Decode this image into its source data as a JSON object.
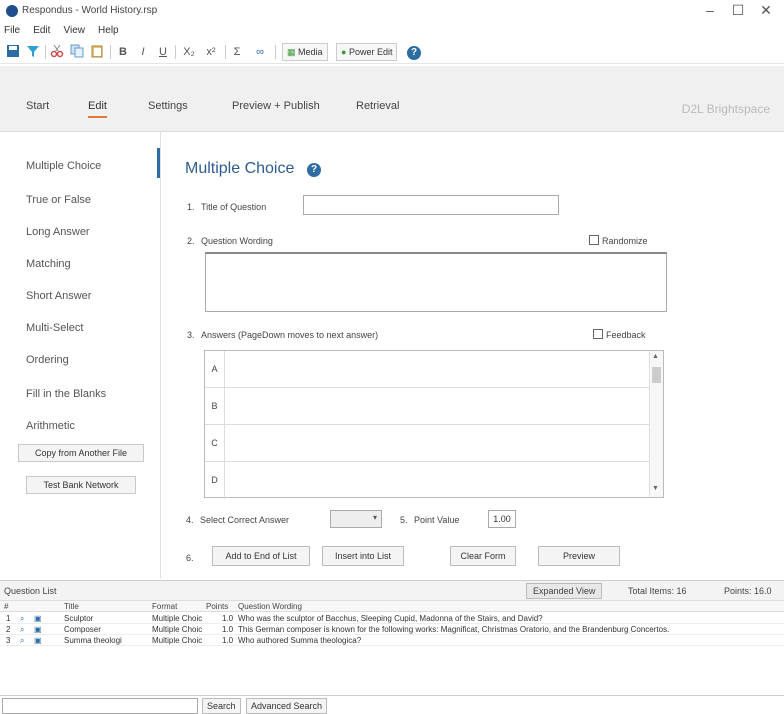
{
  "window": {
    "title": "Respondus - World History.rsp",
    "controls": [
      "–",
      "☐",
      "✕"
    ]
  },
  "menu": [
    "File",
    "Edit",
    "View",
    "Help"
  ],
  "toolbar": {
    "bold": "B",
    "italic": "I",
    "underline": "U",
    "sub": "X₂",
    "sup": "x²",
    "sigma": "Σ",
    "link": "∞",
    "media_label": "Media",
    "power_edit_label": "Power Edit",
    "help": "?"
  },
  "tabs": [
    "Start",
    "Edit",
    "Settings",
    "Preview + Publish",
    "Retrieval"
  ],
  "active_tab": "Edit",
  "lms_label": "D2L Brightspace",
  "sidebar": {
    "items": [
      "Multiple Choice",
      "True or False",
      "Long Answer",
      "Matching",
      "Short Answer",
      "Multi-Select",
      "Ordering",
      "Fill in the Blanks",
      "Arithmetic"
    ],
    "active": "Multiple Choice",
    "copy_button": "Copy from Another File",
    "testbank_button": "Test Bank Network"
  },
  "main": {
    "heading": "Multiple Choice",
    "help_icon": "?",
    "step1": {
      "num": "1.",
      "label": "Title of Question",
      "value": ""
    },
    "step2": {
      "num": "2.",
      "label": "Question Wording",
      "randomize": "Randomize"
    },
    "step3": {
      "num": "3.",
      "label": "Answers (PageDown moves to next answer)",
      "feedback": "Feedback"
    },
    "answer_letters": [
      "A",
      "B",
      "C",
      "D"
    ],
    "step4": {
      "num": "4.",
      "label": "Select Correct Answer",
      "value": ""
    },
    "step5": {
      "num": "5.",
      "label": "Point Value",
      "value": "1.00"
    },
    "step6": {
      "num": "6."
    },
    "buttons": {
      "add": "Add to End of List",
      "insert": "Insert into List",
      "clear": "Clear Form",
      "preview": "Preview"
    }
  },
  "question_list": {
    "title": "Question List",
    "expanded_view": "Expanded View",
    "total_items": "Total Items: 16",
    "points": "Points: 16.0",
    "columns": [
      "#",
      "",
      "",
      "Title",
      "Format",
      "Points",
      "Question Wording"
    ],
    "rows": [
      {
        "n": "1",
        "title": "Sculptor",
        "format": "Multiple Choic",
        "points": "1.0",
        "wording": "Who was the sculptor of Bacchus, Sleeping Cupid, Madonna of the Stairs, and David?"
      },
      {
        "n": "2",
        "title": "Composer",
        "format": "Multiple Choic",
        "points": "1.0",
        "wording": "This German composer is known for the following works: Magnificat, Christmas Oratorio, and the Brandenburg Concertos."
      },
      {
        "n": "3",
        "title": "Summa theologi",
        "format": "Multiple Choic",
        "points": "1.0",
        "wording": "Who authored Summa theologica?"
      }
    ],
    "search_value": "",
    "search_button": "Search",
    "advanced_search_button": "Advanced Search"
  },
  "colors": {
    "accent_blue": "#2e6ca4",
    "active_tab_underline": "#e07b39"
  }
}
